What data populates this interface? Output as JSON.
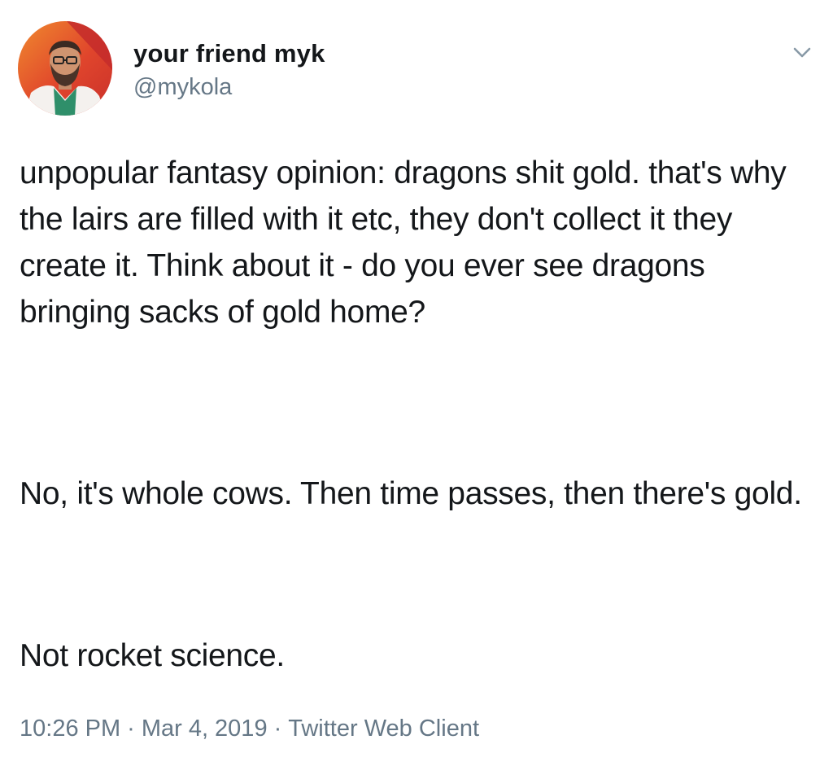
{
  "author": {
    "display_name": "your friend myk",
    "handle": "@mykola"
  },
  "icons": {
    "menu": "chevron-down-icon",
    "avatar": "avatar"
  },
  "tweet": {
    "paragraphs": [
      "unpopular fantasy opinion: dragons shit gold. that's why the lairs are filled with it etc, they don't collect it they create it. Think about it - do you ever see dragons bringing sacks of gold home?",
      "No, it's whole cows. Then time passes, then there's gold.",
      "Not rocket science."
    ]
  },
  "meta": {
    "time": "10:26 PM",
    "separator": "·",
    "date": "Mar 4, 2019",
    "client": "Twitter Web Client"
  },
  "colors": {
    "text_primary": "#14171a",
    "text_secondary": "#657786",
    "background": "#ffffff"
  }
}
